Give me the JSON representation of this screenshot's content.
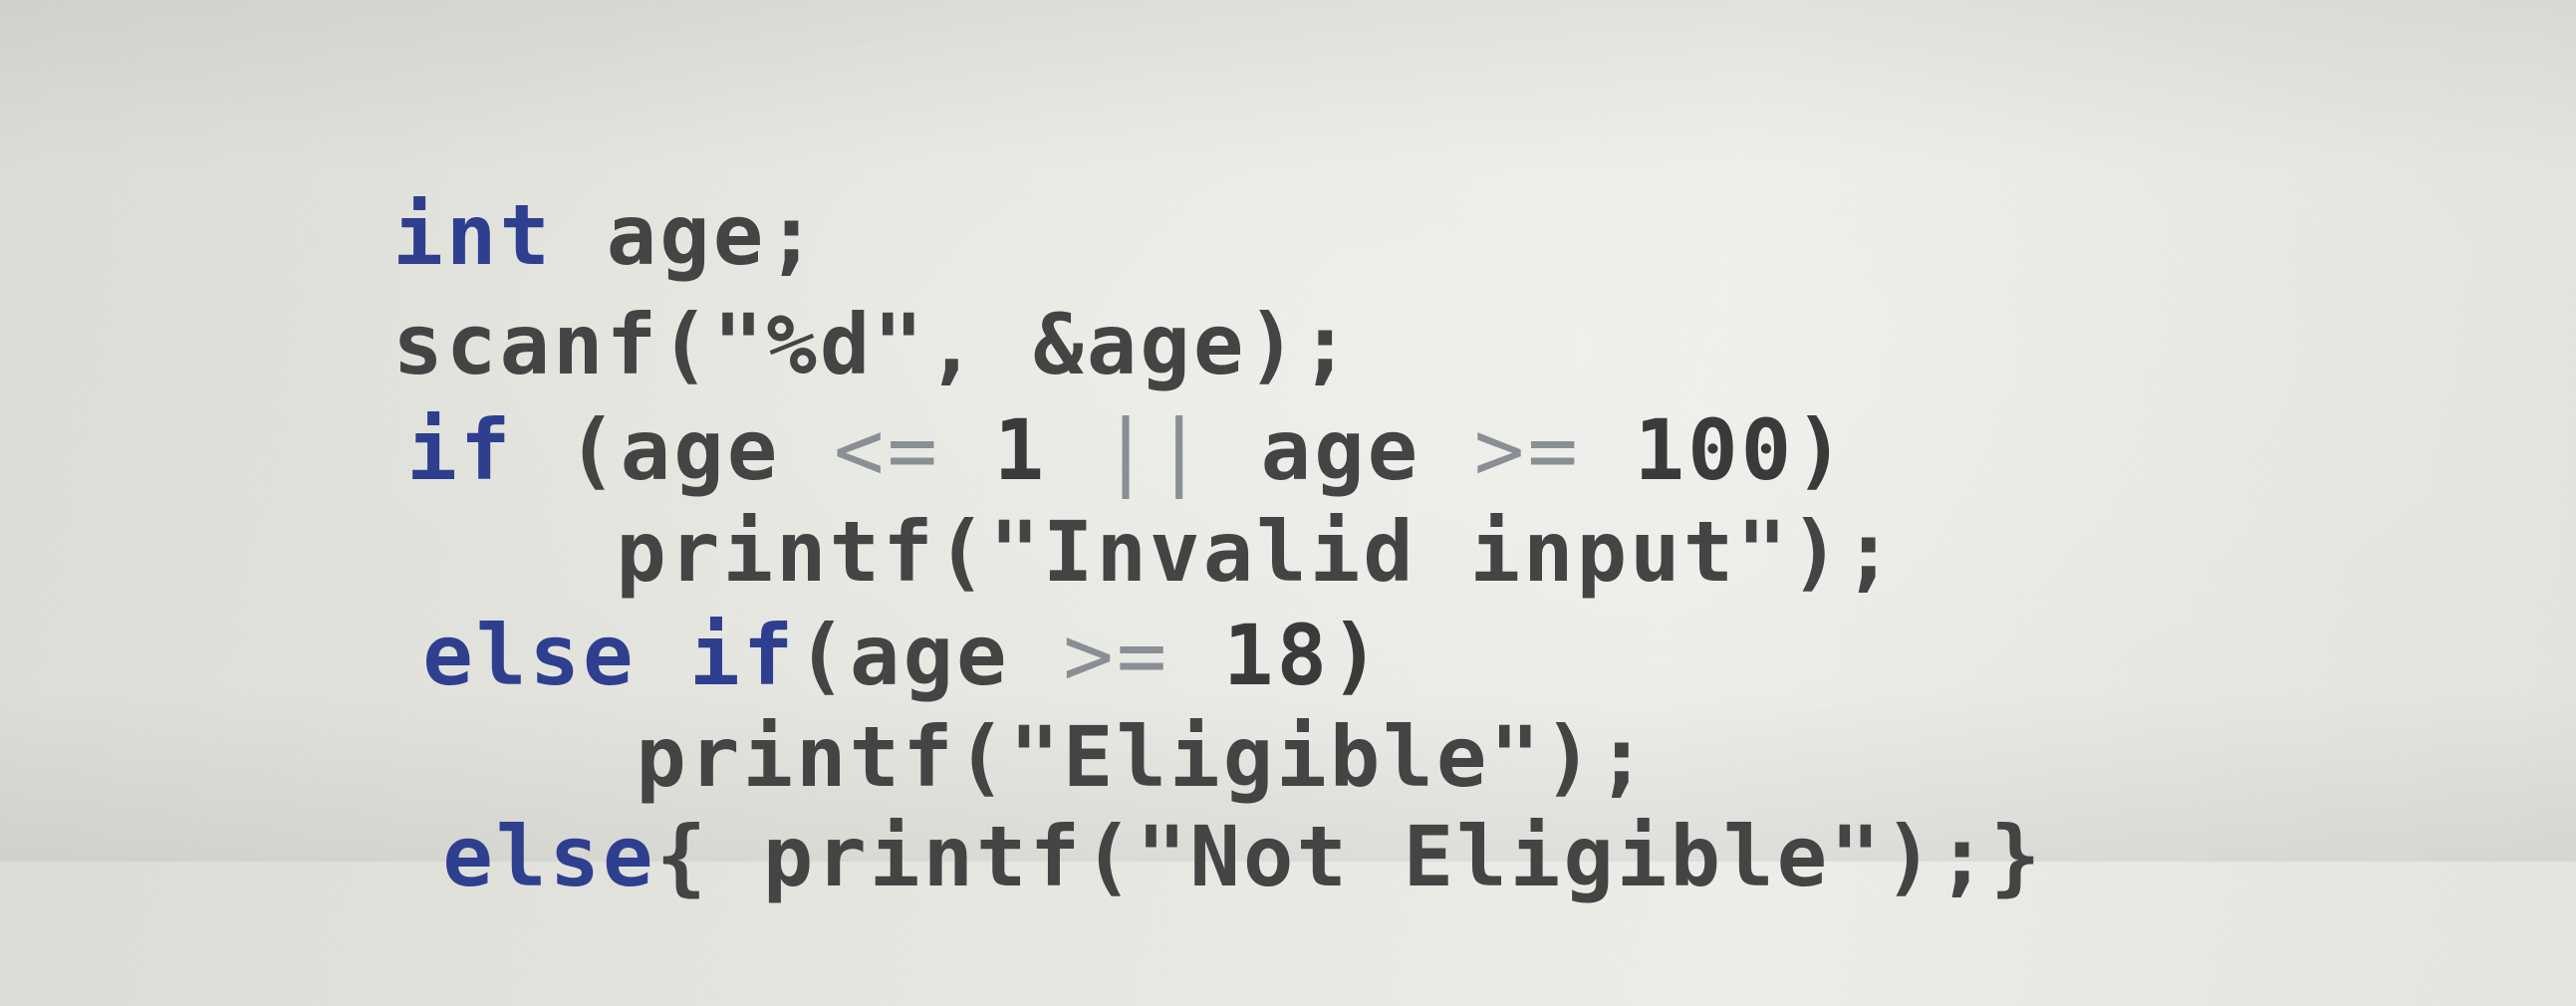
{
  "code_lines": [
    {
      "tokens": [
        {
          "t": "int",
          "c": "kw"
        },
        {
          "t": " age;",
          "c": "plain"
        }
      ]
    },
    {
      "tokens": [
        {
          "t": "scanf(\"%d\", &age);",
          "c": "plain"
        }
      ]
    },
    {
      "tokens": [
        {
          "t": "if",
          "c": "kw"
        },
        {
          "t": " (age ",
          "c": "plain"
        },
        {
          "t": "<=",
          "c": "op"
        },
        {
          "t": " 1 ",
          "c": "num"
        },
        {
          "t": "||",
          "c": "pipe"
        },
        {
          "t": " age ",
          "c": "plain"
        },
        {
          "t": ">=",
          "c": "op"
        },
        {
          "t": " 100)",
          "c": "num"
        }
      ]
    },
    {
      "tokens": [
        {
          "t": "printf(\"Invalid input\");",
          "c": "plain"
        }
      ]
    },
    {
      "tokens": [
        {
          "t": "else if",
          "c": "kw"
        },
        {
          "t": "(age ",
          "c": "plain"
        },
        {
          "t": ">=",
          "c": "op"
        },
        {
          "t": " 18)",
          "c": "num"
        }
      ]
    },
    {
      "tokens": [
        {
          "t": "printf(\"Eligible\");",
          "c": "plain"
        }
      ]
    },
    {
      "tokens": [
        {
          "t": "else",
          "c": "kw"
        },
        {
          "t": "{ printf(\"Not Eligible\");}",
          "c": "plain"
        }
      ]
    }
  ]
}
